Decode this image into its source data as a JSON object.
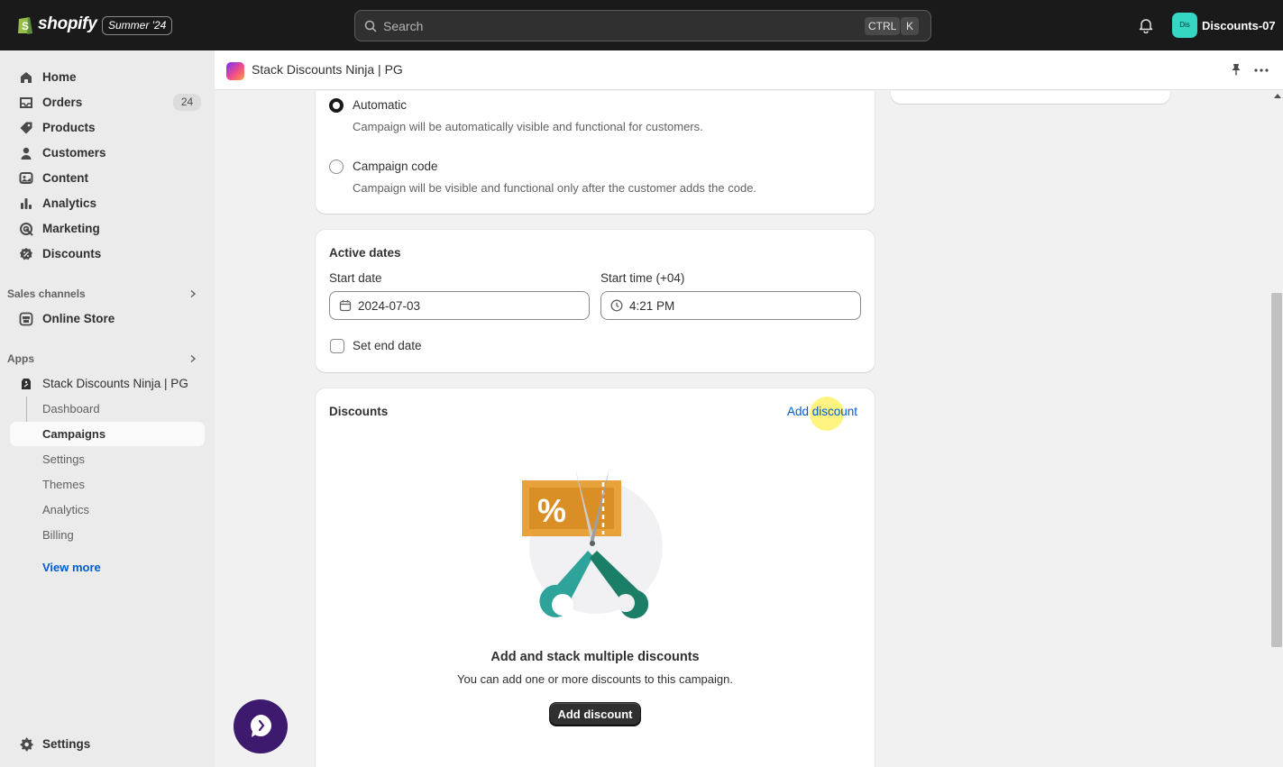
{
  "topbar": {
    "brand": "shopify",
    "edition": "Summer '24",
    "search_placeholder": "Search",
    "shortcut_ctrl": "CTRL",
    "shortcut_key": "K",
    "store_avatar": "Dis",
    "store_name": "Discounts-07"
  },
  "sidebar": {
    "items": [
      {
        "label": "Home",
        "icon": "home-icon"
      },
      {
        "label": "Orders",
        "icon": "orders-icon",
        "badge": "24"
      },
      {
        "label": "Products",
        "icon": "tag-icon"
      },
      {
        "label": "Customers",
        "icon": "person-icon"
      },
      {
        "label": "Content",
        "icon": "content-icon"
      },
      {
        "label": "Analytics",
        "icon": "bar-chart-icon"
      },
      {
        "label": "Marketing",
        "icon": "target-icon"
      },
      {
        "label": "Discounts",
        "icon": "discount-icon"
      }
    ],
    "sales_channels_title": "Sales channels",
    "online_store": "Online Store",
    "apps_title": "Apps",
    "app_name": "Stack Discounts Ninja | PG",
    "app_subitems": [
      "Dashboard",
      "Campaigns",
      "Settings",
      "Themes",
      "Analytics",
      "Billing"
    ],
    "active_subitem": "Campaigns",
    "view_more": "View more",
    "settings": "Settings"
  },
  "app_header": {
    "title": "Stack Discounts Ninja | PG"
  },
  "visibility": {
    "options": [
      {
        "label": "Automatic",
        "help": "Campaign will be automatically visible and functional for customers.",
        "selected": true
      },
      {
        "label": "Campaign code",
        "help": "Campaign will be visible and functional only after the customer adds the code.",
        "selected": false
      }
    ]
  },
  "active_dates": {
    "title": "Active dates",
    "start_date_label": "Start date",
    "start_date_value": "2024-07-03",
    "start_time_label": "Start time (+04)",
    "start_time_value": "4:21 PM",
    "end_date_checkbox": "Set end date",
    "end_date_checked": false
  },
  "discounts": {
    "title": "Discounts",
    "add_link": "Add discount",
    "empty_title": "Add and stack multiple discounts",
    "empty_description": "You can add one or more discounts to this campaign.",
    "add_button": "Add discount"
  },
  "colors": {
    "topbar": "#1a1a1a",
    "link": "#005bd3",
    "store_avatar": "#36d6c3",
    "chat": "#3d1a6e",
    "illustration_orange": "#e8a23b",
    "illustration_teal": "#2ea39a"
  }
}
